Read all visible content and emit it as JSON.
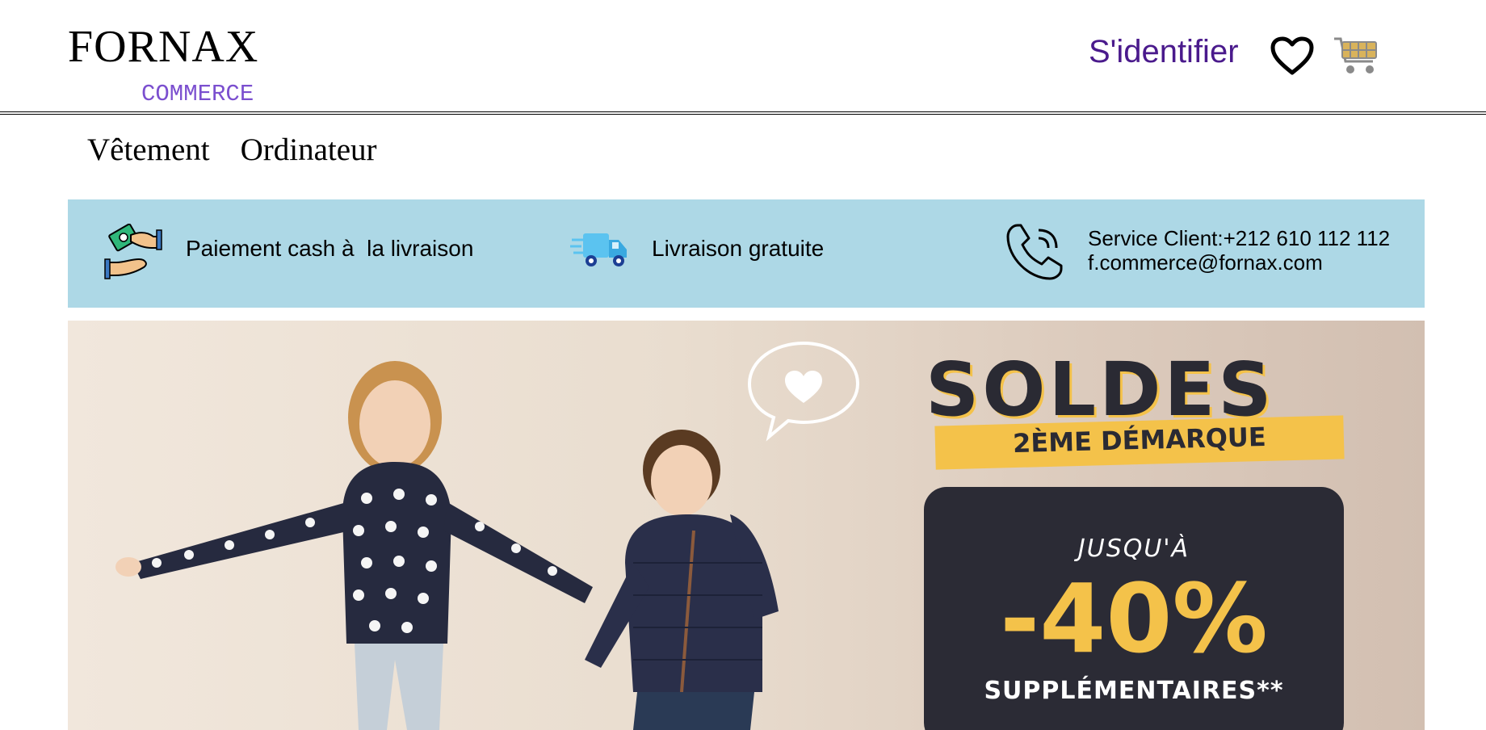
{
  "header": {
    "brand_name": "FORNAX",
    "brand_sub": "COMMERCE",
    "login_label": "S'identifier",
    "icons": [
      "heart-icon",
      "cart-icon"
    ]
  },
  "nav": {
    "items": [
      {
        "label": "Vêtement"
      },
      {
        "label": "Ordinateur"
      }
    ]
  },
  "infobar": {
    "items": [
      {
        "icon": "cash-payment-icon",
        "text": "Paiement cash à  la livraison"
      },
      {
        "icon": "delivery-truck-icon",
        "text": "Livraison gratuite"
      },
      {
        "icon": "phone-icon",
        "line1": "Service Client:+212 610 112 112",
        "line2": "f.commerce@fornax.com"
      }
    ]
  },
  "banner": {
    "title": "SOLDES",
    "subtitle": "2ÈME DÉMARQUE",
    "promo_prefix": "JUSQU'À",
    "promo_value": "-40%",
    "promo_suffix": "SUPPLÉMENTAIRES**"
  },
  "colors": {
    "brand_sub": "#7b4fcf",
    "login": "#4a1a8c",
    "infobar_bg": "#add8e6",
    "promo_yellow": "#f4c24a",
    "promo_dark": "#2b2b35"
  }
}
